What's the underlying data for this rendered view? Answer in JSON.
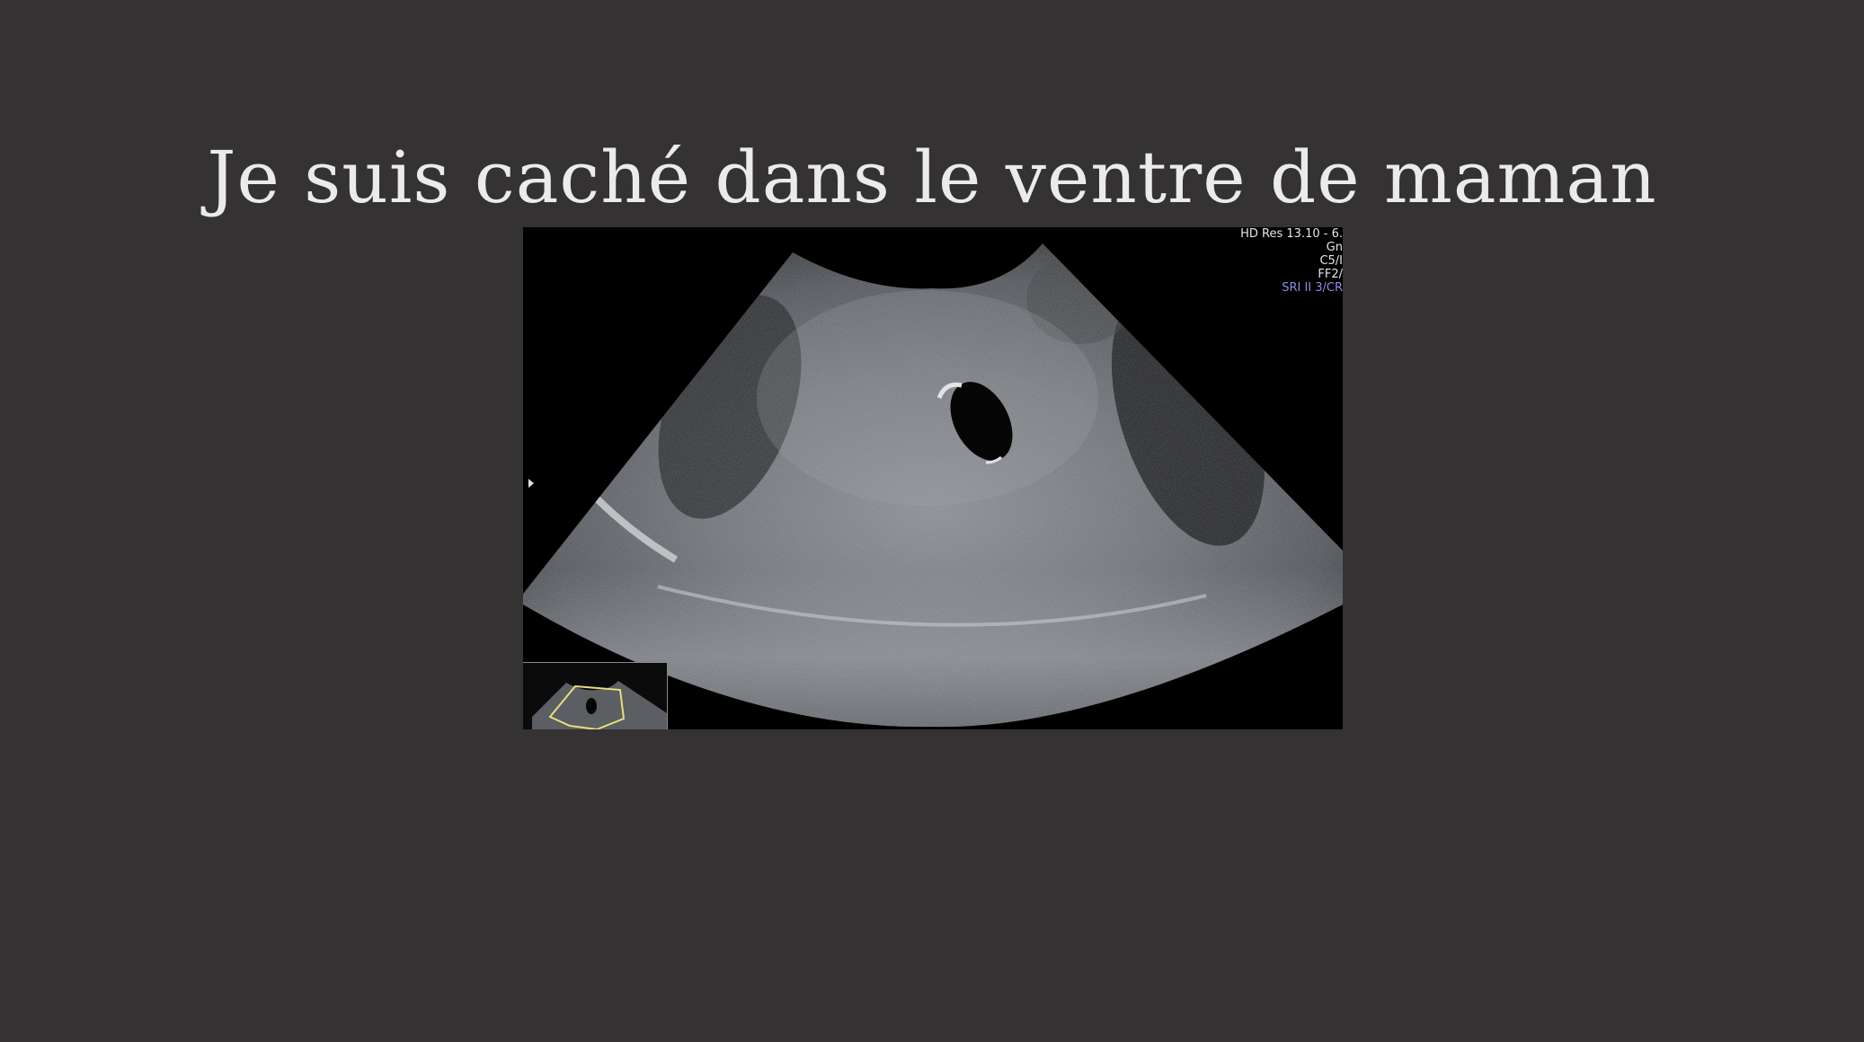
{
  "slide": {
    "title": "Je suis caché dans le ventre de maman"
  },
  "ultrasound": {
    "readout": {
      "line1": "HD Res 13.10 - 6.",
      "line2": "Gn",
      "line3": "C5/I",
      "line4": "FF2/",
      "line5": "SRI II 3/CR"
    },
    "accent_color": "#8d8de8"
  }
}
